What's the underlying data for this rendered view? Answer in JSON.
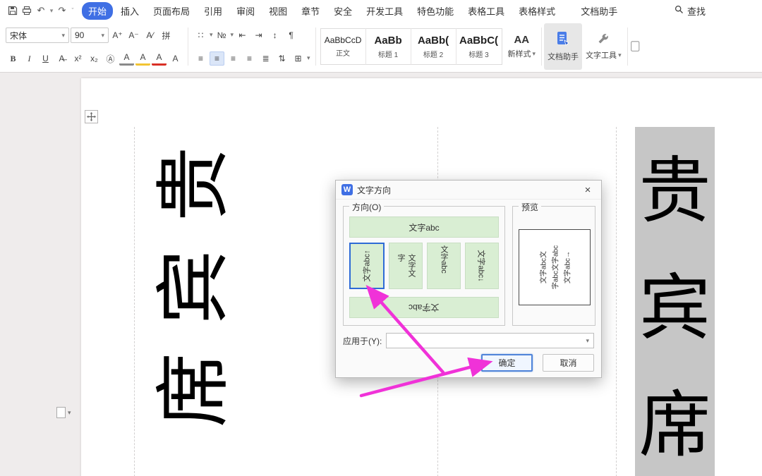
{
  "icons": {
    "caret_down": "▾",
    "chevron_more": "ˇ",
    "undo": "↶",
    "redo": "↷",
    "close": "×",
    "bold": "B",
    "italic": "I",
    "underline": "U",
    "strike": "A̶",
    "superscript": "x²",
    "subscript": "x₂",
    "char_border": "Ⓐ",
    "char_shading": "A",
    "font_color": "A",
    "circle_char": "A",
    "inc_font": "A⁺",
    "dec_font": "A⁻",
    "clear_format": "A∕",
    "phonetic": "拼",
    "bullets": "∷",
    "numbering": "№",
    "outdent": "⇤",
    "indent": "⇥",
    "sort": "↕",
    "para_mark": "¶",
    "align_bars": "≡",
    "distribute": "≣",
    "line_spacing": "⇅",
    "borders": "⊞",
    "new_style_sample": "AA"
  },
  "colors": {
    "accent": "#3f6fe4",
    "option_green": "#d9eed3",
    "selection_gray": "#c6c6c6",
    "arrow_pink": "#f032d8"
  },
  "menubar": {
    "tabs": [
      {
        "label": "开始",
        "active": true
      },
      {
        "label": "插入"
      },
      {
        "label": "页面布局"
      },
      {
        "label": "引用"
      },
      {
        "label": "审阅"
      },
      {
        "label": "视图"
      },
      {
        "label": "章节"
      },
      {
        "label": "安全"
      },
      {
        "label": "开发工具"
      },
      {
        "label": "特色功能"
      },
      {
        "label": "表格工具"
      },
      {
        "label": "表格样式"
      },
      {
        "label": "文档助手"
      }
    ],
    "find_label": "查找"
  },
  "ribbon": {
    "font_name": "宋体",
    "font_size": "90",
    "styles": [
      {
        "sample": "AaBbCcD",
        "name": "正文"
      },
      {
        "sample": "AaBb",
        "name": "标题 1"
      },
      {
        "sample": "AaBb(",
        "name": "标题 2"
      },
      {
        "sample": "AaBbC(",
        "name": "标题 3"
      }
    ],
    "new_style_label": "新样式",
    "doc_assistant_label": "文档助手",
    "text_tool_label": "文字工具"
  },
  "document": {
    "left_vertical_text": [
      "贵",
      "宾",
      "席"
    ],
    "right_vertical_text": [
      "贵",
      "宾",
      "席"
    ]
  },
  "dialog": {
    "title": "文字方向",
    "direction_legend": "方向(O)",
    "preview_legend": "预览",
    "option_horizontal": "文字abc",
    "option_vertical_1": "文字abc↑",
    "option_vertical_2": "文字文字",
    "option_vertical_3": "文字abc",
    "option_vertical_4": "文字abc↓",
    "option_rotated": "文字abc",
    "preview_lines": [
      "文字abc文",
      "字abc文字abc",
      "文字abc→"
    ],
    "apply_label": "应用于(Y):",
    "apply_value": "",
    "ok_label": "确定",
    "cancel_label": "取消"
  }
}
